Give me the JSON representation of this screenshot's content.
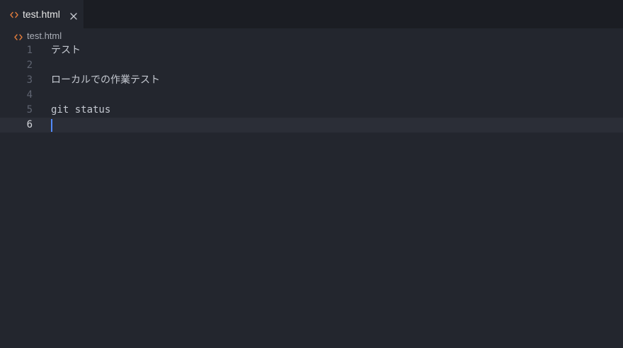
{
  "tab": {
    "label": "test.html",
    "icon": "html-file-icon",
    "accent": "#e07b3c"
  },
  "breadcrumb": {
    "label": "test.html",
    "icon": "html-file-icon"
  },
  "editor": {
    "current_line": 6,
    "lines": [
      {
        "number": "1",
        "text": "テスト"
      },
      {
        "number": "2",
        "text": ""
      },
      {
        "number": "3",
        "text": "ローカルでの作業テスト"
      },
      {
        "number": "4",
        "text": ""
      },
      {
        "number": "5",
        "text": "git status"
      },
      {
        "number": "6",
        "text": ""
      }
    ]
  },
  "colors": {
    "background": "#23262e",
    "tab_bar": "#1b1d23",
    "cursor": "#528bff"
  }
}
